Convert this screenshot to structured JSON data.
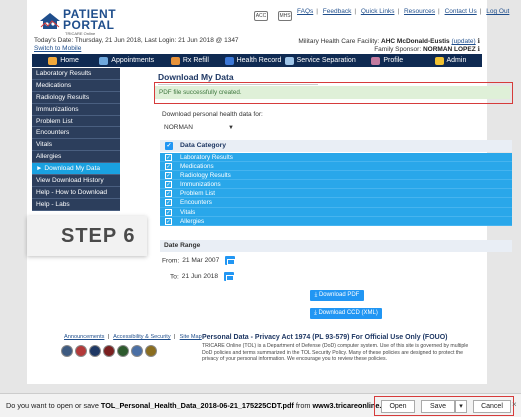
{
  "logo": {
    "line1": "PATIENT",
    "line2": "PORTAL",
    "tagline": "TRICARE Online"
  },
  "topicons": [
    "ACC",
    "MHS"
  ],
  "toplinks": [
    "FAQs",
    "Feedback",
    "Quick Links",
    "Resources",
    "Contact Us",
    "Log Out"
  ],
  "dateline": {
    "text": "Today's Date: Thursday, 21 Jun 2018, Last Login: 21 Jun 2018 @ 1347",
    "mobile": "Switch to Mobile"
  },
  "facility": {
    "label": "Military Health Care Facility:",
    "name": "AHC McDonald-Eustis",
    "update": "(update)",
    "sponsor_label": "Family Sponsor:",
    "sponsor": "NORMAN LOPEZ",
    "info": "ℹ"
  },
  "nav": [
    {
      "label": "Home",
      "icon_color": "#f2a93b"
    },
    {
      "label": "Appointments",
      "icon_color": "#6fa8dc"
    },
    {
      "label": "Rx Refill",
      "icon_color": "#e69138"
    },
    {
      "label": "Health Record",
      "icon_color": "#3c78d8"
    },
    {
      "label": "Service Separation",
      "icon_color": "#9fc5e8"
    },
    {
      "label": "Profile",
      "icon_color": "#c27ba0"
    },
    {
      "label": "Admin",
      "icon_color": "#f1c232"
    }
  ],
  "sidebar": [
    "Laboratory Results",
    "Medications",
    "Radiology Results",
    "Immunizations",
    "Problem List",
    "Encounters",
    "Vitals",
    "Allergies",
    "► Download My Data",
    "View Download History",
    "Help - How to Download",
    "Help - Labs"
  ],
  "sidebar_active": 8,
  "main": {
    "title": "Download My Data",
    "success": "PDF file successfully created.",
    "download_label": "Download personal health data for:",
    "select_value": "NORMAN",
    "category_header": "Data Category",
    "categories": [
      "Laboratory Results",
      "Medications",
      "Radiology Results",
      "Immunizations",
      "Problem List",
      "Encounters",
      "Vitals",
      "Allergies"
    ],
    "date_range": "Date Range",
    "from_label": "From:",
    "from_value": "21 Mar 2007",
    "to_label": "To:",
    "to_value": "21 Jun 2018",
    "btn_pdf": "⤓ Download PDF",
    "btn_ccd": "⤓ Download CCD (XML)"
  },
  "step_label": "STEP 6",
  "footer": {
    "links": [
      "Announcements",
      "Accessibility & Security",
      "Site Map"
    ],
    "title": "Personal Data - Privacy Act 1974 (PL 93-579) For Official Use Only (FOUO)",
    "text": "TRICARE Online (TOL) is a Department of Defense (DoD) computer system. Use of this site is governed by multiple DoD policies and terms summarized in the TOL Security Policy. Many of these policies are designed to protect the privacy of your personal information. We encourage you to review these policies.",
    "seal_colors": [
      "#3d5a80",
      "#b33939",
      "#1f3864",
      "#7a1f1f",
      "#2d5a2d",
      "#4a6fa5",
      "#8a6d1f"
    ]
  },
  "downloadbar": {
    "prefix": "Do you want to open or save ",
    "filename": "TOL_Personal_Health_Data_2018-06-21_175225CDT.pdf",
    "middle": " from ",
    "site": "www3.tricareonline.com",
    "suffix": "?",
    "open": "Open",
    "save": "Save",
    "cancel": "Cancel",
    "close": "×"
  }
}
